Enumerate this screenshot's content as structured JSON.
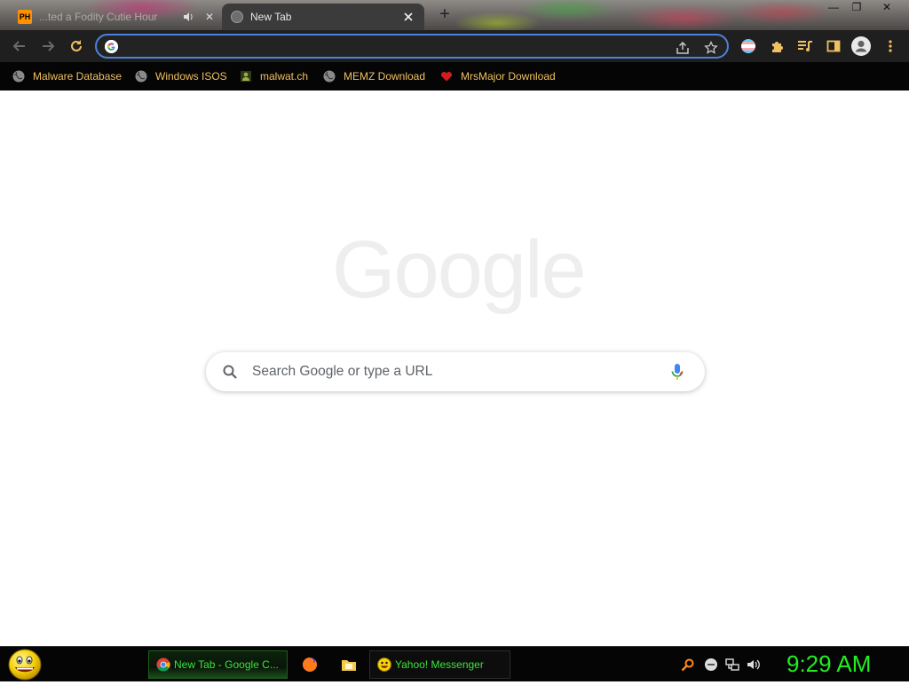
{
  "browser": {
    "tabs": [
      {
        "title": "...ted a Fodity Cutie Hour",
        "favicon": "pornhub-favicon",
        "audio": true
      },
      {
        "title": "New Tab",
        "favicon": "globe-icon",
        "active": true
      }
    ],
    "new_tab_symbol": "+",
    "window_controls": {
      "minimize": "—",
      "maximize": "❐",
      "close": "✕"
    },
    "omnibox": {
      "value": "",
      "placeholder": ""
    },
    "bookmarks": [
      {
        "label": "Malware Database",
        "icon": "globe-icon"
      },
      {
        "label": "Windows ISOS",
        "icon": "globe-icon"
      },
      {
        "label": "malwat.ch",
        "icon": "malwatch-icon"
      },
      {
        "label": "MEMZ Download",
        "icon": "globe-icon"
      },
      {
        "label": "MrsMajor Download",
        "icon": "heart-icon"
      }
    ]
  },
  "newtab": {
    "logo_text": "Google",
    "search_placeholder": "Search Google or type a URL"
  },
  "taskbar": {
    "buttons": [
      {
        "label": "New Tab - Google C...",
        "icon": "chrome-icon",
        "active": true
      },
      {
        "label": "Yahoo! Messenger",
        "icon": "yahoo-smiley-icon"
      }
    ],
    "clock": "9:29 AM"
  },
  "colors": {
    "bookmark_text": "#f0c060",
    "taskbar_text": "#39e639",
    "clock": "#22ee22",
    "omnibox_focus": "#4d82dc"
  }
}
